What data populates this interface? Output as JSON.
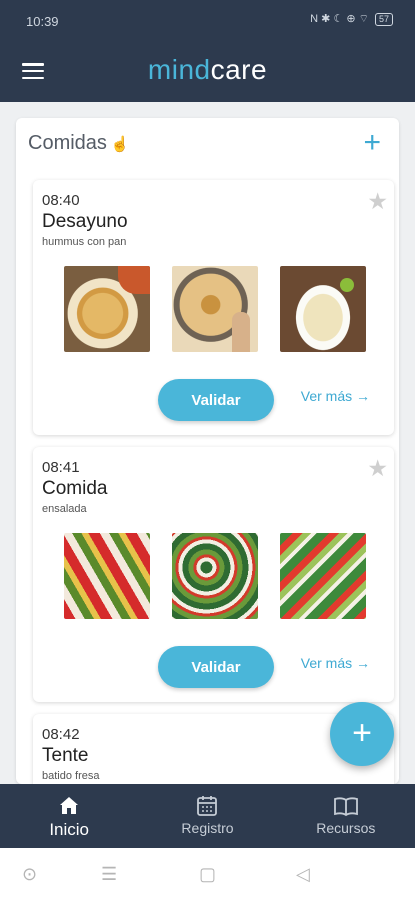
{
  "status": {
    "time": "10:39",
    "icons": "N ✱ ☾ ⊕ ⌔",
    "battery": "57"
  },
  "app": {
    "brand_part1": "mind",
    "brand_part2": "care"
  },
  "section": {
    "title": "Comidas",
    "hand_icon": "☝",
    "add": "+"
  },
  "meals": [
    {
      "time": "08:40",
      "name": "Desayuno",
      "description": "hummus con pan",
      "validate_label": "Validar",
      "more_label": "Ver más",
      "photos": [
        "hummus-bowl-photo",
        "hummus-plate-photo",
        "hummus-soup-photo"
      ]
    },
    {
      "time": "08:41",
      "name": "Comida",
      "description": "ensalada",
      "validate_label": "Validar",
      "more_label": "Ver más",
      "photos": [
        "salad-tomato-photo",
        "salad-greens-photo",
        "salad-mixed-photo"
      ]
    },
    {
      "time": "08:42",
      "name": "Tente",
      "description": "batido fresa"
    }
  ],
  "fab": {
    "label": "+"
  },
  "nav": [
    {
      "label": "Inicio",
      "icon": "home-icon",
      "active": true
    },
    {
      "label": "Registro",
      "icon": "calendar-icon",
      "active": false
    },
    {
      "label": "Recursos",
      "icon": "book-icon",
      "active": false
    }
  ],
  "colors": {
    "header": "#2d3a4e",
    "accent": "#4ab6d9",
    "background": "#eef0f2"
  }
}
